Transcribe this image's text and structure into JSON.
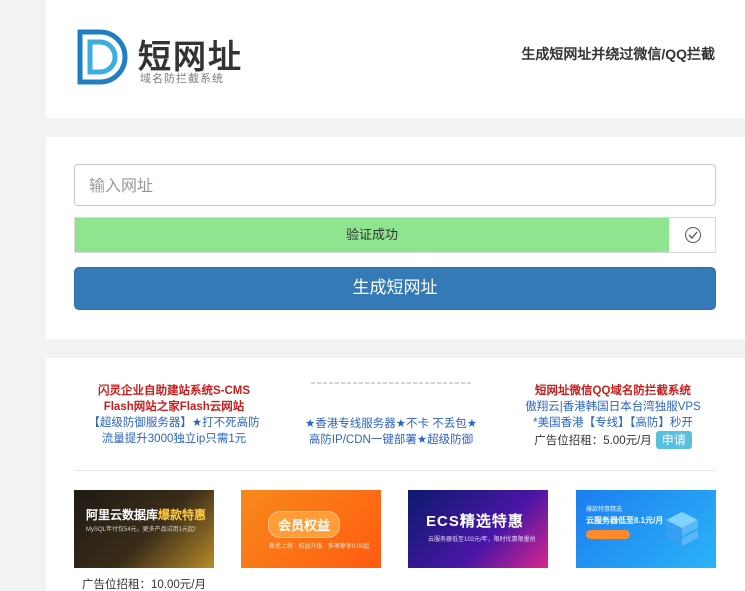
{
  "header": {
    "logo_title": "短网址",
    "logo_subtitle": "域名防拦截系统",
    "slogan": "生成短网址并绕过微信/QQ拦截",
    "logo_icon": "d-letter-logo-icon"
  },
  "form": {
    "url_placeholder": "输入网址",
    "url_value": "",
    "verify_text": "验证成功",
    "verify_progress": 1.0,
    "verify_icon": "check-circle-icon",
    "submit_label": "生成短网址"
  },
  "ads": {
    "left": {
      "line1": "闪灵企业自助建站系统S-CMS",
      "line2": "Flash网站之家Flash云网站",
      "line3": "【超级防御服务器】★打不死高防",
      "line4": "流量提升3000独立ip只需1元"
    },
    "middle": {
      "line1": "★香港专线服务器★不卡 不丢包★",
      "line2": "高防IP/CDN一键部署★超级防御"
    },
    "right": {
      "line1": "短网址微信QQ域名防拦截系统",
      "line2": "傲翔云|香港韩国日本台湾独服VPS",
      "line3": "*美国香港【专线】【高防】秒开",
      "price": "广告位招租：5.00元/月",
      "apply_label": "申请"
    },
    "banners": [
      {
        "title_prefix": "阿里云数据库",
        "title_highlight": "爆款特惠",
        "subtitle": "MySQL年付仅54元，更多产品试用1元起!"
      },
      {
        "title": "会员权益",
        "subtitle": "新老上线 · 权益升级 · 多项尊享0.00起"
      },
      {
        "title": "ECS精选特惠",
        "subtitle": "云服务器低至102元/年，限时优惠限量抢"
      },
      {
        "tag": "爆款特惠精选",
        "title": "云服务器低至8.1元/月"
      }
    ],
    "footer_price": "广告位招租：10.00元/月"
  },
  "colors": {
    "primary": "#337ab7",
    "success": "#8fe58f",
    "logo": "#1f7fc0",
    "ad_red": "#c81e1e",
    "ad_blue": "#2a64c5",
    "apply": "#5bc0de"
  }
}
